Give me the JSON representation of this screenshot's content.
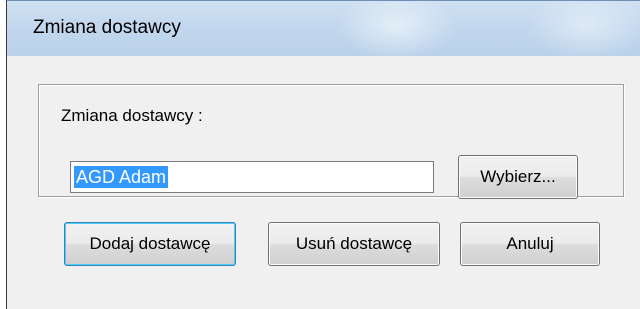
{
  "window": {
    "title": "Zmiana dostawcy"
  },
  "form": {
    "group_label": "Zmiana dostawcy :",
    "supplier_value": "AGD Adam",
    "choose_label": "Wybierz..."
  },
  "buttons": {
    "add_label": "Dodaj dostawcę",
    "remove_label": "Usuń dostawcę",
    "cancel_label": "Anuluj"
  },
  "colors": {
    "titlebar": "#c3d8ee",
    "selection": "#3399ff",
    "face": "#f0f0f0"
  }
}
